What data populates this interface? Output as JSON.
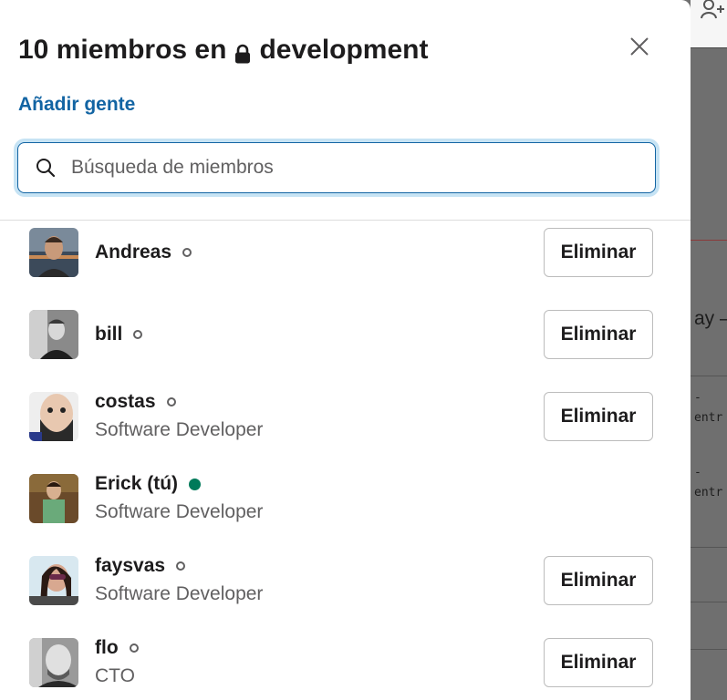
{
  "modal": {
    "title_prefix": "10 miembros en",
    "channel_name": "development",
    "add_people_label": "Añadir gente",
    "search_placeholder": "Búsqueda de miembros",
    "remove_label": "Eliminar"
  },
  "members": [
    {
      "name": "Andreas",
      "title": "",
      "presence": "away",
      "removable": true
    },
    {
      "name": "bill",
      "title": "",
      "presence": "away",
      "removable": true
    },
    {
      "name": "costas",
      "title": "Software Developer",
      "presence": "away",
      "removable": true
    },
    {
      "name": "Erick (tú)",
      "title": "Software Developer",
      "presence": "active",
      "removable": false
    },
    {
      "name": "faysvas",
      "title": "Software Developer",
      "presence": "away",
      "removable": true
    },
    {
      "name": "flo",
      "title": "CTO",
      "presence": "away",
      "removable": true
    }
  ],
  "background": {
    "text_1": "ay –",
    "mono_1": "-\nentr",
    "mono_2": "-\nentr"
  },
  "colors": {
    "accent": "#1264a3",
    "active": "#007a5a",
    "text": "#1d1c1d",
    "muted": "#616061"
  }
}
